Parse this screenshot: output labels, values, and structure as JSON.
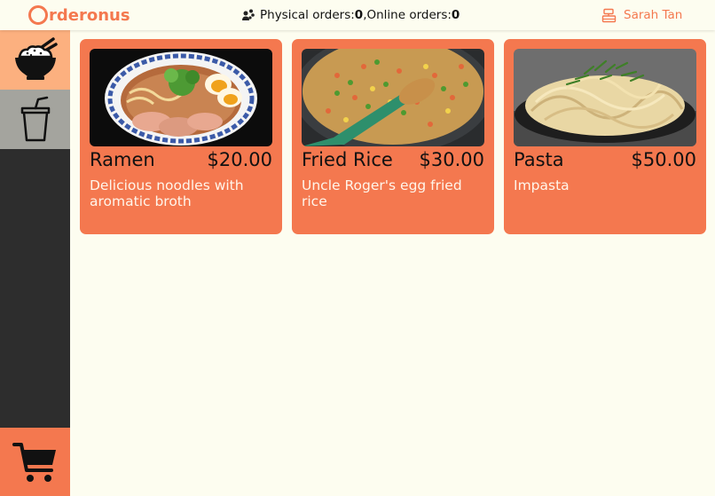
{
  "header": {
    "logo_text": "rderonus",
    "physical_label": "Physical orders: ",
    "physical_count": "0",
    "separator": ", ",
    "online_label": "Online orders: ",
    "online_count": "0",
    "user_name": "Sarah Tan"
  },
  "sidebar": {
    "items": [
      {
        "icon": "rice-bowl-icon",
        "active": true
      },
      {
        "icon": "drink-cup-icon",
        "active": false
      }
    ],
    "cart_icon": "cart-icon"
  },
  "menu": {
    "items": [
      {
        "name": "Ramen",
        "price": "$20.00",
        "description": "Delicious noodles with aromatic broth",
        "image": "ramen-image"
      },
      {
        "name": "Fried Rice",
        "price": "$30.00",
        "description": "Uncle Roger's egg fried rice",
        "image": "fried-rice-image"
      },
      {
        "name": "Pasta",
        "price": "$50.00",
        "description": "Impasta",
        "image": "pasta-image"
      }
    ]
  },
  "colors": {
    "accent": "#f4784f",
    "background": "#fdfdf0",
    "sidebar": "#2d2d2d",
    "active_tab": "#fcb07f",
    "inactive_tab": "#a4a49e"
  }
}
